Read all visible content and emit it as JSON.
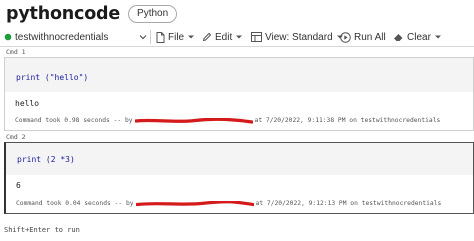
{
  "notebook": {
    "title": "pythoncode",
    "language": "Python"
  },
  "toolbar": {
    "cluster_name": "testwithnocredentials",
    "file_label": "File",
    "edit_label": "Edit",
    "view_label": "View: Standard",
    "run_all_label": "Run All",
    "clear_label": "Clear",
    "cluster_status_color": "#1e9e3a"
  },
  "cells": [
    {
      "label": "Cmd 1",
      "code": "print (\"hello\")",
      "output": "hello",
      "took_before": "Command took 0.98 seconds -- by",
      "took_after": "at 7/20/2022, 9:11:38 PM on testwithnocredentials"
    },
    {
      "label": "Cmd 2",
      "code": "print (2 *3)",
      "output": "6",
      "took_before": "Command took 0.04 seconds -- by",
      "took_after": "at 7/20/2022, 9:12:13 PM on testwithnocredentials"
    }
  ],
  "footer": {
    "hint": "Shift+Enter to run"
  },
  "colors": {
    "redaction": "#d41a1a",
    "code_text": "#1a1a9e"
  }
}
